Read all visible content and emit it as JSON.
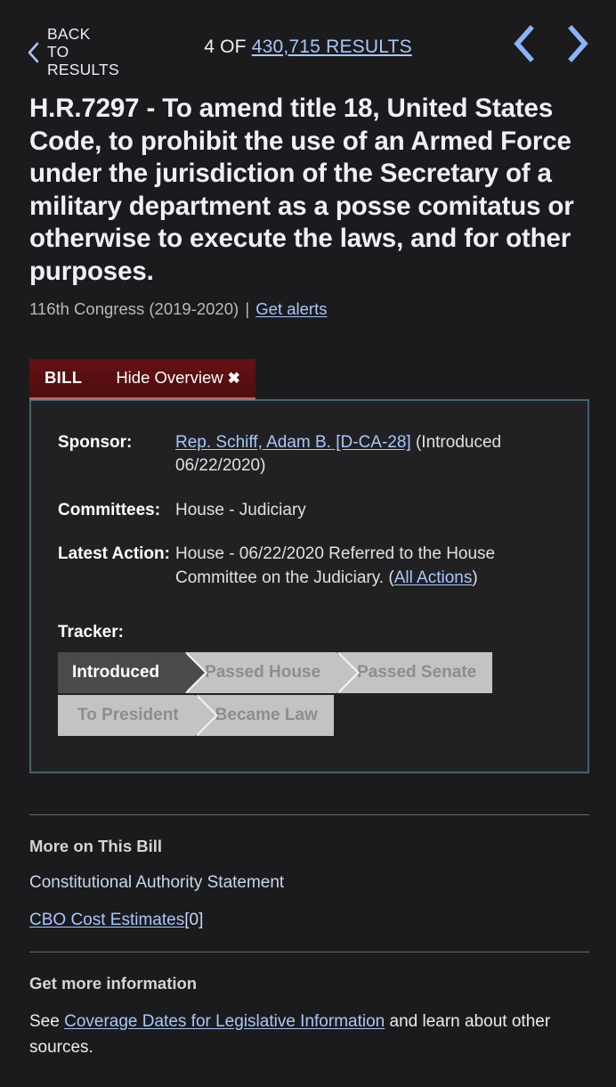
{
  "topbar": {
    "back_label": "BACK TO\nRESULTS",
    "back_icon": "chevron-left-icon",
    "results_prefix": "4 OF",
    "results_link": "430,715 RESULTS",
    "prev_icon": "chevron-left-icon",
    "next_icon": "chevron-right-icon"
  },
  "bill": {
    "title": "H.R.7297 - To amend title 18, United States Code, to prohibit the use of an Armed Force under the jurisdiction of the Secretary of a military department as a posse comitatus or otherwise to execute the laws, and for other purposes.",
    "congress": "116th Congress (2019-2020)",
    "separator": "|",
    "alerts_link": "Get alerts"
  },
  "overview": {
    "tab_name": "BILL",
    "toggle_label": "Hide Overview",
    "toggle_icon": "close-x-icon",
    "fields": {
      "sponsor_label": "Sponsor:",
      "sponsor_link": "Rep. Schiff, Adam B. [D-CA-28]",
      "sponsor_suffix": "(Introduced 06/22/2020)",
      "committees_label": "Committees:",
      "committees_value": "House - Judiciary",
      "latest_action_label": "Latest Action:",
      "latest_action_value": "House - 06/22/2020 Referred to the House Committee on the Judiciary.",
      "latest_action_open_paren": "(",
      "latest_action_link": "All Actions",
      "latest_action_close_paren": ")"
    },
    "tracker": {
      "label": "Tracker:",
      "steps": [
        {
          "label": "Introduced",
          "active": true
        },
        {
          "label": "Passed House",
          "active": false
        },
        {
          "label": "Passed Senate",
          "active": false
        },
        {
          "label": "To President",
          "active": false
        },
        {
          "label": "Became Law",
          "active": false
        }
      ]
    }
  },
  "more_on_bill": {
    "title": "More on This Bill",
    "links": [
      {
        "label": "Constitutional Authority Statement",
        "underlined": false,
        "suffix": ""
      },
      {
        "label": "CBO Cost Estimates",
        "underlined": true,
        "suffix": " [0]"
      }
    ]
  },
  "get_more_info": {
    "title": "Get more information",
    "text_before": "See ",
    "link": "Coverage Dates for Legislative Information",
    "text_after": " and learn about other sources."
  },
  "colors": {
    "page_bg": "#1b1b1d",
    "panel_bg": "#212124",
    "panel_border": "#48606e",
    "tab_maroon": "#5c0f12",
    "link_blue": "#a8c7fa",
    "tracker_active": "#4a4a4a",
    "tracker_inactive": "#c3c3c3"
  }
}
